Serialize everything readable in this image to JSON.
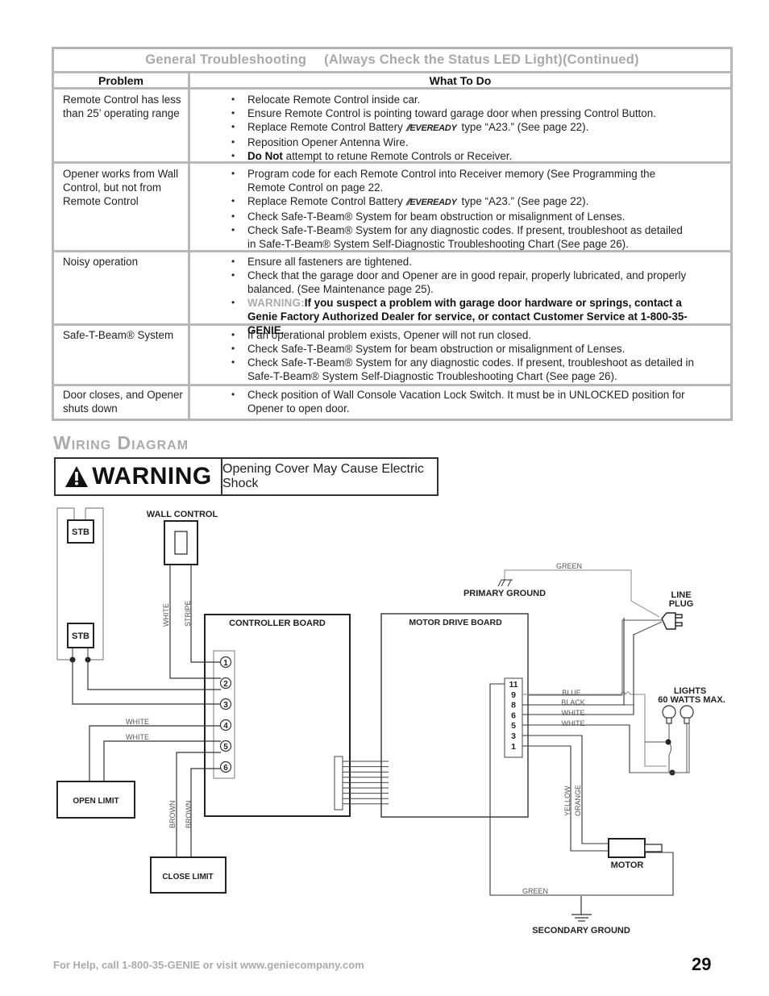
{
  "troubleshooting": {
    "title_part1": "General Troubleshooting",
    "title_part2": "(Always Check the Status LED Light)(Continued)",
    "col_problem": "Problem",
    "col_todo": "What To Do",
    "rows": [
      {
        "problem": "Remote Control has less than 25’ operating range",
        "items": [
          "Relocate Remote Control inside car.",
          "Ensure Remote Control is pointing toward garage door when pressing Control Button.",
          {
            "pre": "Replace Remote Control Battery",
            "brand": "EVEREADY",
            "post": "type “A23.”  (See page 22)."
          },
          "Reposition Opener Antenna Wire.",
          {
            "bold": "Do Not",
            "post": "attempt to retune Remote Controls or Receiver."
          }
        ]
      },
      {
        "problem": "Opener works from Wall Control, but not from Remote Control",
        "items": [
          "Program code for each Remote Control into Receiver memory (See Programming the Remote Control on page 22.",
          {
            "pre": "Replace Remote Control Battery",
            "brand": "EVEREADY",
            "post": "type “A23.”  (See page 22)."
          },
          "Check Safe-T-Beam® System for beam obstruction or misalignment of Lenses.",
          "Check Safe-T-Beam® System for any diagnostic codes.  If present, troubleshoot as detailed in Safe-T-Beam® System Self-Diagnostic Troubleshooting Chart (See page 26)."
        ]
      },
      {
        "problem": "Noisy operation",
        "items": [
          "Ensure all fasteners are tightened.",
          "Check that the garage door and Opener are in good repair, properly lubricated, and properly balanced.  (See Maintenance page 25).",
          {
            "warn": "WARNING:",
            "bold": "If you suspect a problem with garage door hardware or springs, contact a Genie Factory Authorized Dealer for service, or contact Customer Service at 1-800-35-GENIE."
          }
        ]
      },
      {
        "problem": "Safe-T-Beam® System",
        "items": [
          " If an operational problem exists, Opener will not run closed.",
          "Check Safe-T-Beam® System for beam obstruction or misalignment of Lenses.",
          "Check Safe-T-Beam® System for any diagnostic codes. If present, troubleshoot as detailed in Safe-T-Beam® System Self-Diagnostic Troubleshooting Chart (See page 26)."
        ]
      },
      {
        "problem": "Door closes, and Opener shuts down",
        "items": [
          "Check position of Wall Console Vacation Lock Switch.  It must be in UNLOCKED position for Opener to open door."
        ]
      }
    ]
  },
  "wiring": {
    "section_title": "Wiring Diagram",
    "warning_word": "WARNING",
    "warning_text": "Opening Cover May Cause Electric Shock",
    "labels": {
      "stb_top": "STB",
      "stb_bottom": "STB",
      "wall_control": "WALL CONTROL",
      "wire_white_wc": "WHITE",
      "wire_stripe": "STRIPE",
      "controller_board": "CONTROLLER BOARD",
      "terminals": [
        "1",
        "2",
        "3",
        "4",
        "5",
        "6"
      ],
      "wire_white_4": "WHITE",
      "wire_white_5": "WHITE",
      "open_limit": "OPEN LIMIT",
      "close_limit": "CLOSE LIMIT",
      "wire_brown_1": "BROWN",
      "wire_brown_2": "BROWN",
      "wire_green_top": "GREEN",
      "primary_ground": "PRIMARY GROUND",
      "line_plug_1": "LINE",
      "line_plug_2": "PLUG",
      "motor_drive_board": "MOTOR DRIVE BOARD",
      "mdb_pins": [
        "11",
        "9",
        "8",
        "6",
        "5",
        "3",
        "1"
      ],
      "wire_blue": "BLUE",
      "wire_black": "BLACK",
      "wire_white_6": "WHITE",
      "wire_white_5b": "WHITE",
      "lights_1": "LIGHTS",
      "lights_2": "60 WATTS MAX.",
      "wire_yellow": "YELLOW",
      "wire_orange": "ORANGE",
      "motor": "MOTOR",
      "wire_green_bottom": "GREEN",
      "secondary_ground": "SECONDARY GROUND"
    }
  },
  "footer": {
    "help_text": "For Help, call 1-800-35-GENIE or visit www.geniecompany.com",
    "page_number": "29"
  }
}
